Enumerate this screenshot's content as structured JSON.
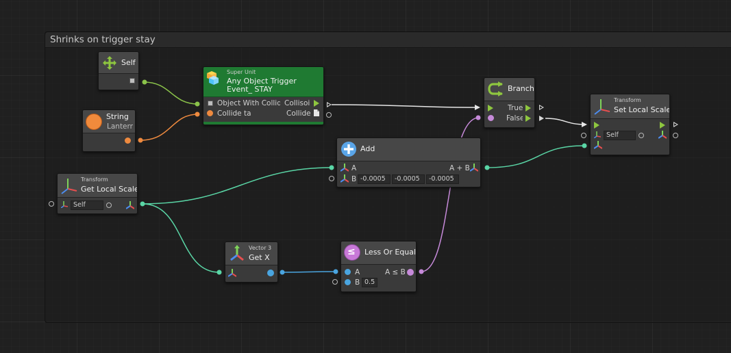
{
  "group": {
    "title": "Shrinks on trigger stay"
  },
  "nodes": {
    "self": {
      "title": "Self"
    },
    "string": {
      "title": "String",
      "value": "Lantern"
    },
    "trigger": {
      "subtitle": "Super Unit",
      "title_line1": "Any Object Trigger",
      "title_line2": "Event_ STAY",
      "in1": "Object With Collid",
      "in2": "Collide  ta",
      "out1": "Collisoi",
      "out2": "Collide"
    },
    "branch": {
      "title": "Branch",
      "out_true": "True",
      "out_false": "False"
    },
    "set_scale": {
      "subtitle": "Transform",
      "title": "Set Local Scale",
      "target": "Self"
    },
    "add": {
      "title": "Add",
      "in_a": "A",
      "in_b": "B",
      "out": "A + B",
      "b_x": "-0.0005",
      "b_y": "-0.0005",
      "b_z": "-0.0005"
    },
    "get_scale": {
      "subtitle": "Transform",
      "title": "Get Local Scale",
      "target": "Self"
    },
    "get_x": {
      "subtitle": "Vector 3",
      "title": "Get X"
    },
    "less_equal": {
      "title": "Less Or Equal",
      "in_a": "A",
      "in_b": "B",
      "out": "A ≤ B",
      "b_value": "0.5"
    }
  },
  "colors": {
    "flow": "#8ec63f",
    "object": "#8bc34a",
    "string": "#ee8a3f",
    "vector": "#5ad6a6",
    "float": "#4aa5e0",
    "bool": "#c68ad9",
    "control_wire": "#e0e0e0",
    "header_green": "#1f7a32"
  },
  "icons": [
    "self-icon",
    "string-icon",
    "super-unit-icon",
    "branch-icon",
    "transform-icon",
    "add-icon",
    "vector3-icon",
    "less-or-equal-icon"
  ]
}
